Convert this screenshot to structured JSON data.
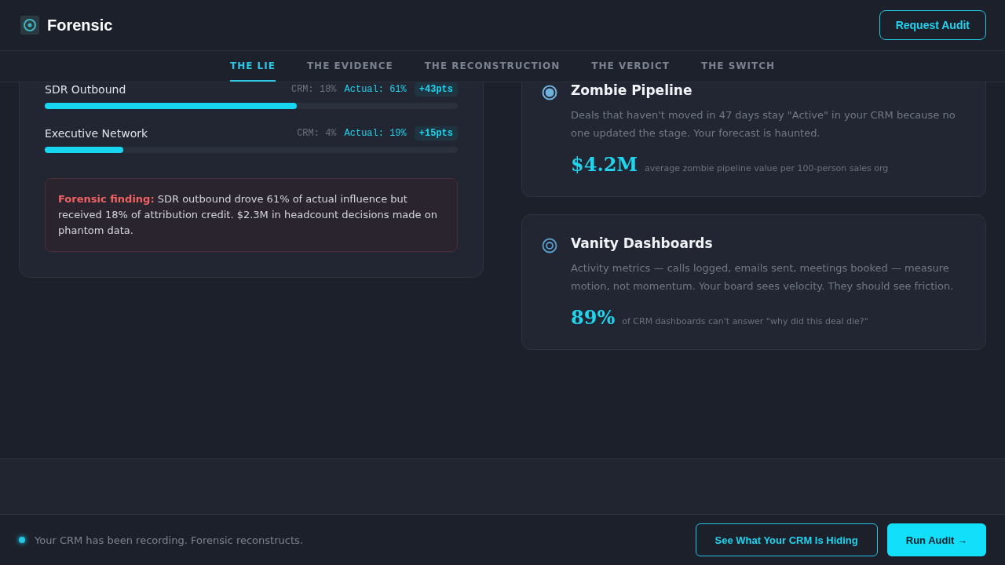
{
  "brand": {
    "name": "Forensic"
  },
  "header_button": "Request Audit",
  "tabs": [
    {
      "label": "THE LIE",
      "selected": true
    },
    {
      "label": "THE EVIDENCE",
      "selected": false
    },
    {
      "label": "THE RECONSTRUCTION",
      "selected": false
    },
    {
      "label": "THE VERDICT",
      "selected": false
    },
    {
      "label": "THE SWITCH",
      "selected": false
    }
  ],
  "channels": [
    {
      "name": "SDR Outbound",
      "crm": "CRM: 18%",
      "actual": "Actual: 61%",
      "delta": "+43pts",
      "level": 0.61
    },
    {
      "name": "Executive Network",
      "crm": "CRM: 4%",
      "actual": "Actual: 19%",
      "delta": "+15pts",
      "level": 0.19
    }
  ],
  "finding": "**Forensic finding:** SDR outbound drove 61% of actual influence but received 18% of attribution credit. $2.3M in headcount decisions made on phantom data.",
  "problems": [
    {
      "kind": "dot",
      "title": "Zombie Pipeline",
      "text": "Deals that haven't moved in 47 days stay \"Active\" in your CRM because no one updated the stage. Your forecast is haunted.",
      "stat": "$4.2M",
      "stat_note": "average zombie pipeline value per 100-person sales org"
    },
    {
      "kind": "target",
      "title": "Vanity Dashboards",
      "text": "Activity metrics — calls logged, emails sent, meetings booked — measure motion, not momentum. Your board sees velocity. They should see friction.",
      "stat": "89%",
      "stat_note": "of CRM dashboards can't answer \"why did this deal die?\""
    }
  ],
  "footer": {
    "status": "Your CRM has been recording. Forensic reconstructs.",
    "secondary": "See What Your CRM Is Hiding",
    "primary": "Run Audit →"
  }
}
